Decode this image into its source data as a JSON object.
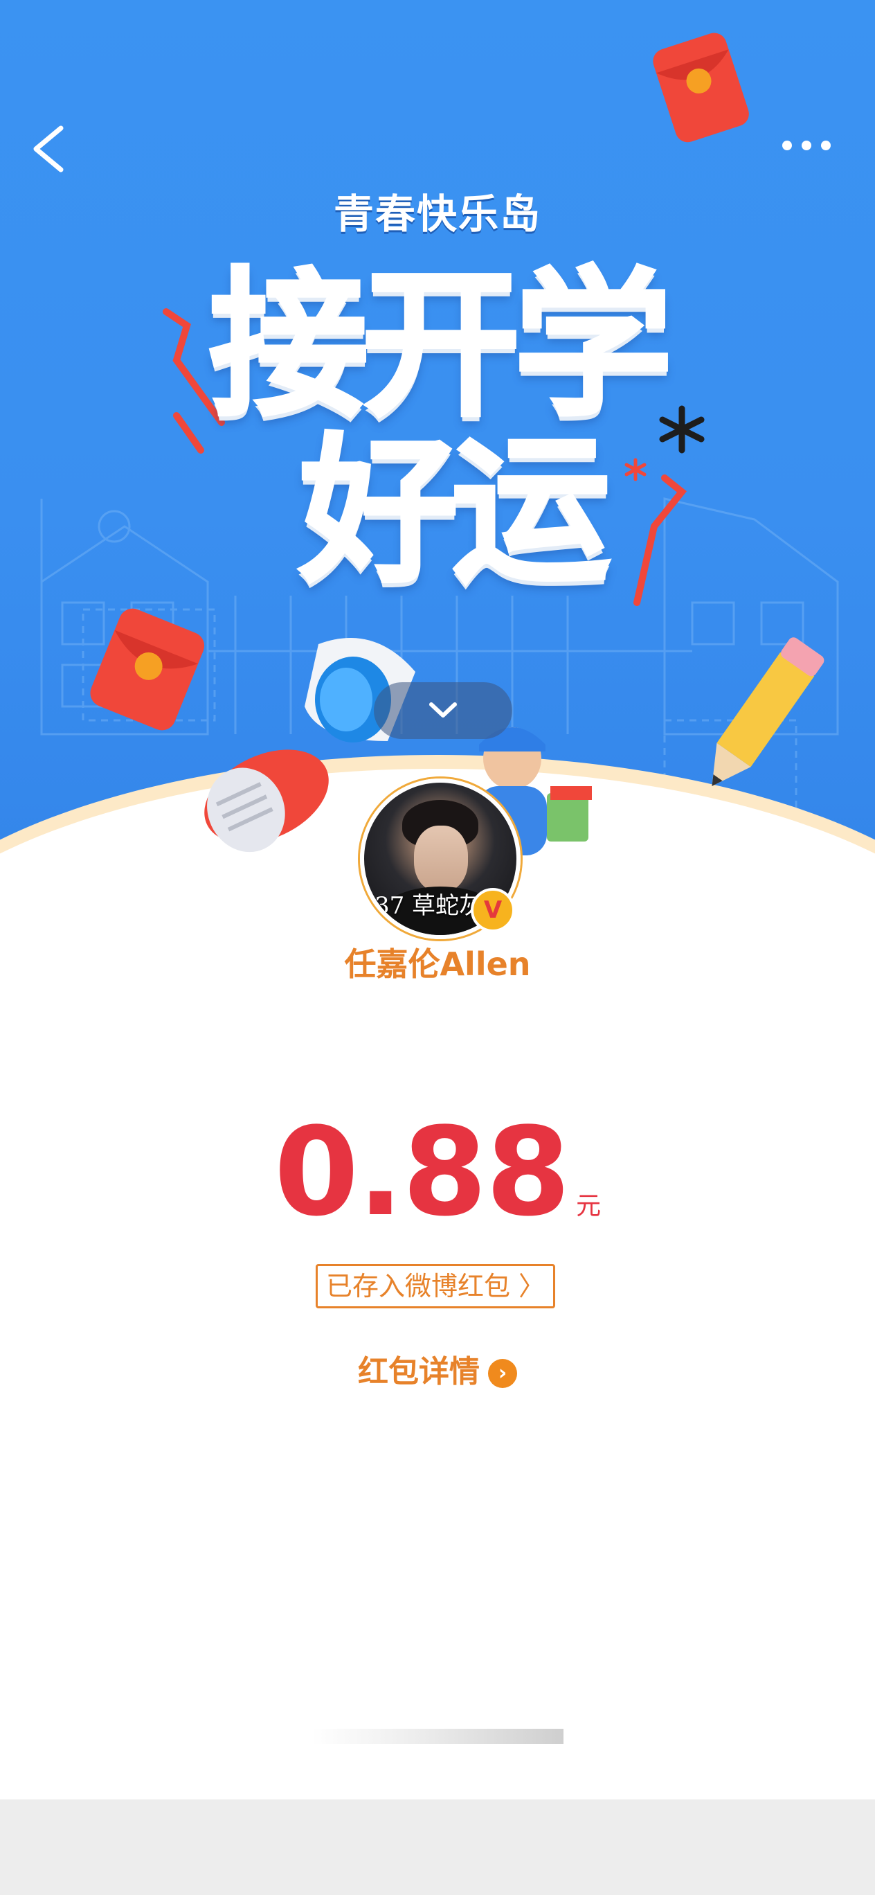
{
  "header": {
    "back_icon": "chevron-left-icon",
    "more_icon": "more-horizontal-icon"
  },
  "banner": {
    "brand": "青春快乐岛",
    "headline_line1": "接开学",
    "headline_line2": "好运",
    "collapse_icon": "chevron-down-icon",
    "background_color": "#3b93f2"
  },
  "sender": {
    "avatar_caption": "37 草蛇灰线",
    "verified_badge": "V",
    "name": "任嘉伦Allen"
  },
  "amount": {
    "value": "0.88",
    "unit": "元",
    "color": "#e63441"
  },
  "saved_button": {
    "label": "已存入微博红包 〉"
  },
  "details_link": {
    "label": "红包详情",
    "icon": "chevron-right-circle-icon",
    "color": "#e7822a"
  }
}
